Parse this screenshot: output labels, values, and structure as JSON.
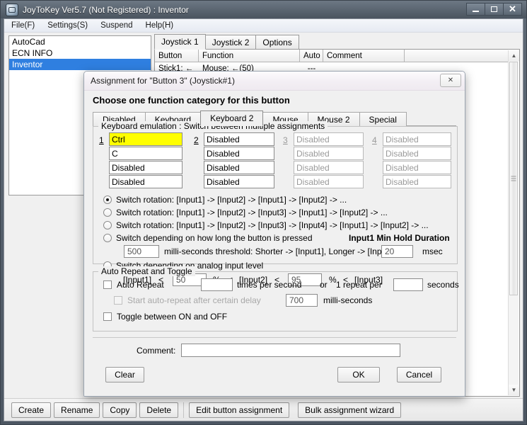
{
  "window": {
    "title": "JoyToKey Ver5.7 (Not Registered) : Inventor",
    "app_icon": "joystick-icon",
    "controls": {
      "minimize": "minimize-icon",
      "maximize": "maximize-icon",
      "close": "✕"
    }
  },
  "menu": [
    {
      "label": "File(F)"
    },
    {
      "label": "Settings(S)"
    },
    {
      "label": "Suspend"
    },
    {
      "label": "Help(H)"
    }
  ],
  "profiles": [
    {
      "label": "AutoCad",
      "selected": false
    },
    {
      "label": "ECN INFO",
      "selected": false
    },
    {
      "label": "Inventor",
      "selected": true
    }
  ],
  "main_tabs": [
    {
      "label": "Joystick 1",
      "active": true
    },
    {
      "label": "Joystick 2",
      "active": false
    },
    {
      "label": "Options",
      "active": false
    }
  ],
  "grid": {
    "columns": [
      "Button",
      "Function",
      "Auto",
      "Comment",
      ""
    ],
    "rows": [
      {
        "button": "Stick1: ←",
        "function": "Mouse: ←(50)",
        "auto": "---",
        "comment": ""
      }
    ],
    "scroll_up_arrow": "▲",
    "scroll_down_arrow": "▼"
  },
  "bottom_toolbar": {
    "create": "Create",
    "rename": "Rename",
    "copy": "Copy",
    "delete": "Delete",
    "edit_button_assignment": "Edit button assignment",
    "bulk_assignment_wizard": "Bulk assignment wizard"
  },
  "dialog": {
    "title": "Assignment for \"Button 3\" (Joystick#1)",
    "close_glyph": "✕",
    "heading": "Choose one function category for this button",
    "category_tabs": [
      {
        "label": "Disabled",
        "active": false
      },
      {
        "label": "Keyboard",
        "active": false
      },
      {
        "label": "Keyboard 2",
        "active": true
      },
      {
        "label": "Mouse",
        "active": false
      },
      {
        "label": "Mouse 2",
        "active": false
      },
      {
        "label": "Special",
        "active": false
      }
    ],
    "keyboard_group": {
      "legend": "Keyboard emulation : Switch between multiple assignments",
      "columns": [
        {
          "number": "1",
          "enabled": true,
          "fields": [
            {
              "value": "Ctrl",
              "highlight": true
            },
            {
              "value": "C",
              "highlight": false
            },
            {
              "value": "Disabled",
              "highlight": false
            },
            {
              "value": "Disabled",
              "highlight": false
            }
          ]
        },
        {
          "number": "2",
          "enabled": true,
          "fields": [
            {
              "value": "Disabled",
              "highlight": false
            },
            {
              "value": "Disabled",
              "highlight": false
            },
            {
              "value": "Disabled",
              "highlight": false
            },
            {
              "value": "Disabled",
              "highlight": false
            }
          ]
        },
        {
          "number": "3",
          "enabled": false,
          "fields": [
            {
              "value": "Disabled",
              "highlight": false
            },
            {
              "value": "Disabled",
              "highlight": false
            },
            {
              "value": "Disabled",
              "highlight": false
            },
            {
              "value": "Disabled",
              "highlight": false
            }
          ]
        },
        {
          "number": "4",
          "enabled": false,
          "fields": [
            {
              "value": "Disabled",
              "highlight": false
            },
            {
              "value": "Disabled",
              "highlight": false
            },
            {
              "value": "Disabled",
              "highlight": false
            },
            {
              "value": "Disabled",
              "highlight": false
            }
          ]
        }
      ],
      "options": [
        {
          "label": "Switch rotation: [Input1] -> [Input2] -> [Input1] -> [Input2] -> ...",
          "checked": true
        },
        {
          "label": "Switch rotation: [Input1] -> [Input2] -> [Input3] -> [Input1] -> [Input2] -> ...",
          "checked": false
        },
        {
          "label": "Switch rotation: [Input1] -> [Input2] -> [Input3] -> [Input4] -> [Input1] -> [Input2] -> ...",
          "checked": false
        },
        {
          "label": "Switch depending on how long the button is pressed",
          "checked": false
        },
        {
          "label": "Switch depending on analog input level",
          "checked": false
        }
      ],
      "hold_duration_label": "Input1 Min Hold Duration",
      "hold_duration_value": "20",
      "hold_duration_unit": "msec",
      "threshold_value": "500",
      "threshold_label": "milli-seconds threshold: Shorter -> [Input1], Longer -> [Input2]",
      "analog_input1": "[Input1]",
      "analog_lt1": "<",
      "analog_value1": "50",
      "analog_pct1": "%",
      "analog_lt2": "<",
      "analog_input2": "[Input2]",
      "analog_lt3": "<",
      "analog_value2": "95",
      "analog_pct2": "%",
      "analog_lt4": "<",
      "analog_input3": "[Input3]"
    },
    "repeat_group": {
      "legend": "Auto Repeat and Toggle",
      "auto_repeat_label": "Auto Repeat",
      "auto_repeat_checked": false,
      "times_per_second_value": "",
      "times_per_second_label": "times per second",
      "or_label": "or",
      "one_repeat_per_label": "1 repeat per",
      "seconds_value": "",
      "seconds_label": "seconds",
      "delay_label": "Start auto-repeat after certain delay",
      "delay_checked": false,
      "delay_value": "700",
      "delay_unit": "milli-seconds",
      "toggle_label": "Toggle between ON and OFF",
      "toggle_checked": false
    },
    "comment_label": "Comment:",
    "comment_value": "",
    "clear_button": "Clear",
    "ok_button": "OK",
    "cancel_button": "Cancel"
  },
  "colors": {
    "highlight_yellow": "#ffff00",
    "selection_blue": "#2f7fe0",
    "titlebar_dark": "#5e6975"
  }
}
